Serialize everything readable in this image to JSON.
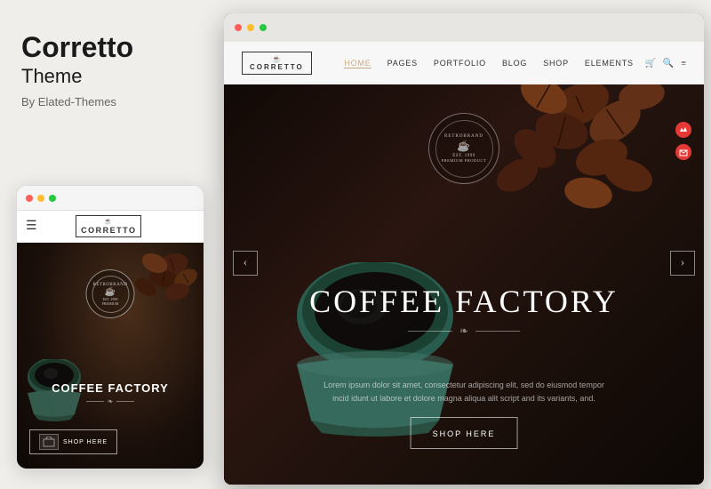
{
  "left": {
    "title": "Corretto",
    "subtitle": "Theme",
    "author": "By Elated-Themes"
  },
  "nav": {
    "logo": "CORRETTO",
    "logo_icon": "☕",
    "links": [
      "HOME",
      "PAGES",
      "PORTFOLIO",
      "BLOG",
      "SHOP",
      "ELEMENTS"
    ],
    "active_link": "HOME"
  },
  "hero": {
    "badge_top": "RETROBRAND",
    "badge_middle": "☕",
    "badge_year": "EST. 1999",
    "badge_sub": "PREMIUM PRODUCT",
    "title": "COFFEE FACTORY",
    "divider_icon": "❧",
    "description": "Lorem ipsum dolor sit amet, consectetur adipiscing elit, sed do eiusmod tempor incid idunt ut labore et dolore magna aliqua alit script and its variants, and.",
    "shop_button": "SHOP HERE"
  },
  "mobile": {
    "logo": "CORRETTO",
    "title": "COFFEE FACTORY",
    "shop_text": "shop HeRE"
  },
  "browser": {
    "dots": [
      "red",
      "yellow",
      "green"
    ]
  }
}
